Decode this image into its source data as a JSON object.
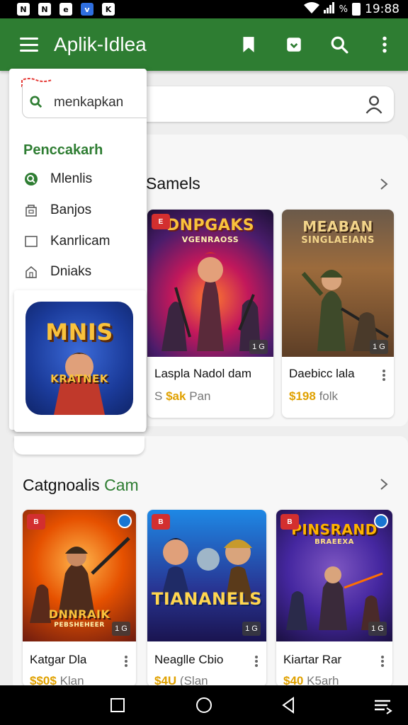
{
  "status_bar": {
    "icons": [
      "N",
      "N",
      "e",
      "v",
      "K"
    ],
    "percent": "%",
    "time": "19:88"
  },
  "app_bar": {
    "title": "Aplik-Idlea"
  },
  "drawer": {
    "search_text": "menkapkan",
    "heading": "Penccakarh",
    "items": [
      {
        "label": "Mlenlis",
        "icon": "search-circle-icon"
      },
      {
        "label": "Banjos",
        "icon": "store-icon"
      },
      {
        "label": "Kanrlicam",
        "icon": "square-icon"
      },
      {
        "label": "Dniaks",
        "icon": "house-icon"
      }
    ],
    "app_tile": {
      "top_text": "MNIS",
      "bottom_text": "KRATNEK"
    }
  },
  "sections": [
    {
      "title": "Samels",
      "title_green": "",
      "games": [
        {
          "art_top": "DNPGAKS",
          "art_sub": "VGENRAOSS",
          "badge": "E",
          "rating": "1 G",
          "name": "Laspla Nadol dam",
          "price": "$ak",
          "price_suffix": "Pan",
          "price_prefix": "S"
        },
        {
          "art_top": "MEABAN",
          "art_sub": "SINGLAEIANS",
          "badge": "",
          "rating": "1 G",
          "name": "Daebicc lala",
          "price": "$198",
          "price_suffix": "folk",
          "price_prefix": ""
        }
      ]
    },
    {
      "title": "Catgnoalis ",
      "title_green": "Cam",
      "games": [
        {
          "art_top": "DNNRAIK",
          "art_sub": "PEBSHEHEER",
          "badge": "B",
          "rating": "1 G",
          "name": "Katgar Dla",
          "price": "$$0$",
          "price_suffix": "Klan",
          "price_prefix": ""
        },
        {
          "art_top": "TIANANELS",
          "art_sub": "",
          "badge": "B",
          "rating": "1 G",
          "name": "Neaglle Cbio",
          "price": "$4U",
          "price_suffix": "(Slan",
          "price_prefix": ""
        },
        {
          "art_top": "PINSRAND",
          "art_sub": "BRAEEXA",
          "badge": "B",
          "rating": "1 G",
          "name": "Kiartar Rar",
          "price": "$40",
          "price_suffix": "K5arh",
          "price_prefix": ""
        }
      ]
    }
  ],
  "colors": {
    "primary": "#2e7d32",
    "price_accent": "#e0a100"
  }
}
